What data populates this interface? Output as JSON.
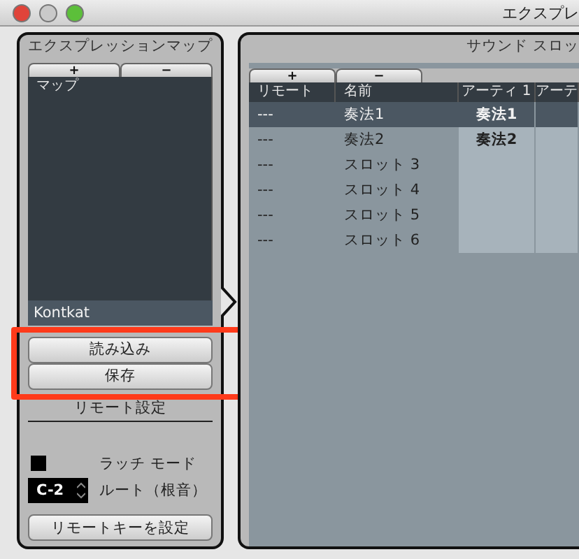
{
  "window": {
    "title": "エクスプレ"
  },
  "expression_map": {
    "title": "エクスプレッションマップ",
    "toolbar": [
      "+",
      "−"
    ],
    "column": "マップ",
    "items": [
      {
        "label": "Kontkat",
        "selected": true
      }
    ],
    "file_buttons": {
      "highlighted": true,
      "labels": [
        "読み込み",
        "保存"
      ]
    },
    "remote_settings": {
      "title": "リモート設定",
      "latch": {
        "label": "ラッチ モード",
        "checked": false
      },
      "root": {
        "value": "C-2",
        "label": "ルート（根音）"
      },
      "button": "リモートキーを設定"
    }
  },
  "sound_slots": {
    "title": "サウンド スロッ",
    "toolbar": [
      "+",
      "−"
    ],
    "columns": [
      "リモート",
      "名前",
      "アーティ 1",
      "アーテ"
    ],
    "rows": [
      {
        "remote": "---",
        "name": "奏法1",
        "art_1": "奏法1",
        "selected": true
      },
      {
        "remote": "---",
        "name": "奏法2",
        "art_1": "奏法2",
        "selected": false
      },
      {
        "remote": "---",
        "name": "スロット 3",
        "selected": false
      },
      {
        "remote": "---",
        "name": "スロット 4",
        "selected": false
      },
      {
        "remote": "---",
        "name": "スロット 5",
        "selected": false
      },
      {
        "remote": "---",
        "name": "スロット 6",
        "selected": false
      }
    ]
  }
}
